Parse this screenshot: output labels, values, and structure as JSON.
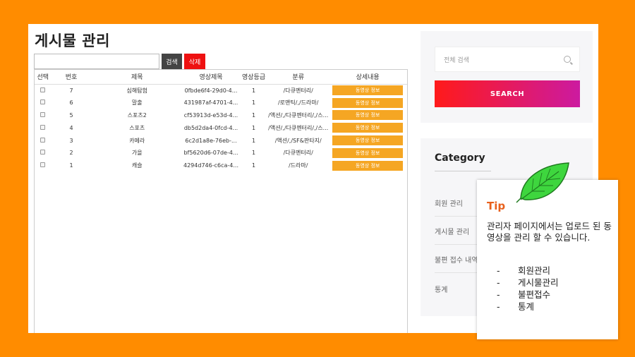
{
  "page": {
    "title": "게시물 관리",
    "search_button": "검색",
    "delete_button": "삭제"
  },
  "table": {
    "headers": [
      "선택",
      "번호",
      "제목",
      "영상제목",
      "영상등급",
      "분류",
      "상세내용"
    ],
    "rows": [
      {
        "num": "7",
        "title": "심해탐험",
        "video": "0fbde6f4-29d0-4...",
        "grade": "1",
        "category": "/다큐멘터리/",
        "detail": "동영상 정보"
      },
      {
        "num": "6",
        "title": "말출",
        "video": "431987af-4701-4...",
        "grade": "1",
        "category": "/로맨틱/,/드라마/",
        "detail": "동영상 정보"
      },
      {
        "num": "5",
        "title": "스포츠2",
        "video": "cf53913d-e53d-4...",
        "grade": "1",
        "category": "/액션/,/다큐멘터리/,/스...",
        "detail": "동영상 정보"
      },
      {
        "num": "4",
        "title": "스포츠",
        "video": "db5d2da4-0fcd-4...",
        "grade": "1",
        "category": "/액션/,/다큐멘터리/,/스...",
        "detail": "동영상 정보"
      },
      {
        "num": "3",
        "title": "카메라",
        "video": "6c2d1a8e-76eb-...",
        "grade": "1",
        "category": "/액션/,/SF&판타지/",
        "detail": "동영상 정보"
      },
      {
        "num": "2",
        "title": "가을",
        "video": "bf5620d6-07de-4...",
        "grade": "1",
        "category": "/다큐멘터리/",
        "detail": "동영상 정보"
      },
      {
        "num": "1",
        "title": "캐슬",
        "video": "4294d746-c6ca-4...",
        "grade": "1",
        "category": "/드라마/",
        "detail": "동영상 정보"
      }
    ]
  },
  "sidebar": {
    "search_placeholder": "전체 검색",
    "search_button": "SEARCH",
    "category_title": "Category",
    "items": [
      "회원 관리",
      "게시물 관리",
      "불편 접수 내역",
      "통계"
    ]
  },
  "tip": {
    "title": "Tip",
    "body": "관리자 페이지에서는 업로드 된 동영상을 관리 할 수 있습니다.",
    "list": [
      "회원관리",
      "게시물관리",
      "불편접수",
      "통계"
    ]
  },
  "colors": {
    "background": "#ff8c00",
    "delete": "#ee1111",
    "detail_button": "#f5a623",
    "tip_title": "#e8601c"
  }
}
